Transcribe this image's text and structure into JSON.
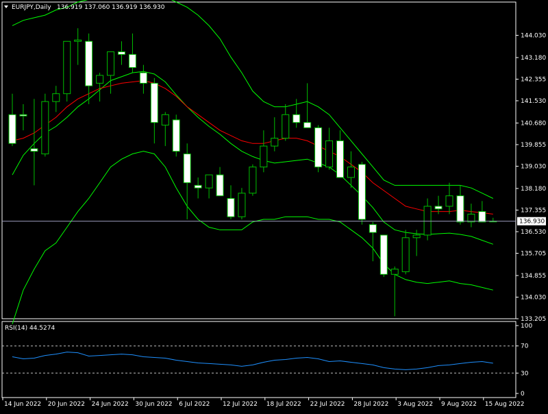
{
  "window": {
    "symbol_title": "EURJPY,Daily",
    "ohlc_readout": "136.919 137.060 136.919 136.930",
    "indicator_label": "RSI(14) 44.5274"
  },
  "colors": {
    "background": "#000000",
    "frame": "#ffffff",
    "bull_candle": "#000000",
    "bear_candle": "#ffffff",
    "candle_outline": "#00c000",
    "ma_middle": "#ff0000",
    "bollinger": "#00ff00",
    "rsi_line": "#1e90ff",
    "price_line": "#a0a0c0",
    "rsi_level": "#c0c0c0"
  },
  "chart_data": [
    {
      "type": "candlestick",
      "price_axis_labels": [
        "144.030",
        "143.180",
        "142.355",
        "141.530",
        "140.680",
        "139.855",
        "139.030",
        "138.180",
        "137.355",
        "136.530",
        "135.705",
        "134.855",
        "134.030",
        "133.205"
      ],
      "current_price_label": "136.930",
      "ylim": [
        133.205,
        145.3
      ],
      "date_labels": [
        "14 Jun 2022",
        "20 Jun 2022",
        "24 Jun 2022",
        "30 Jun 2022",
        "6 Jul 2022",
        "12 Jul 2022",
        "18 Jul 2022",
        "22 Jul 2022",
        "28 Jul 2022",
        "3 Aug 2022",
        "9 Aug 2022",
        "15 Aug 2022"
      ],
      "date_label_bar_index": [
        0,
        4,
        8,
        12,
        16,
        20,
        24,
        28,
        32,
        36,
        40,
        44
      ],
      "candles": [
        {
          "o": 141.0,
          "h": 141.8,
          "l": 139.8,
          "c": 139.9
        },
        {
          "o": 141.0,
          "h": 141.4,
          "l": 140.4,
          "c": 140.95
        },
        {
          "o": 139.7,
          "h": 141.6,
          "l": 138.3,
          "c": 139.6
        },
        {
          "o": 139.5,
          "h": 141.8,
          "l": 139.4,
          "c": 141.5
        },
        {
          "o": 141.5,
          "h": 142.1,
          "l": 141.1,
          "c": 141.8
        },
        {
          "o": 141.8,
          "h": 143.3,
          "l": 141.5,
          "c": 143.8
        },
        {
          "o": 143.8,
          "h": 144.3,
          "l": 142.9,
          "c": 143.85
        },
        {
          "o": 143.8,
          "h": 144.1,
          "l": 141.4,
          "c": 142.1
        },
        {
          "o": 142.2,
          "h": 142.6,
          "l": 141.5,
          "c": 142.5
        },
        {
          "o": 142.5,
          "h": 143.4,
          "l": 141.8,
          "c": 143.4
        },
        {
          "o": 143.4,
          "h": 143.8,
          "l": 142.9,
          "c": 143.3
        },
        {
          "o": 143.3,
          "h": 144.1,
          "l": 142.6,
          "c": 142.8
        },
        {
          "o": 142.6,
          "h": 142.9,
          "l": 141.8,
          "c": 142.2
        },
        {
          "o": 142.2,
          "h": 142.4,
          "l": 139.9,
          "c": 140.7
        },
        {
          "o": 140.6,
          "h": 141.1,
          "l": 139.8,
          "c": 141.0
        },
        {
          "o": 140.8,
          "h": 141.0,
          "l": 139.4,
          "c": 139.6
        },
        {
          "o": 139.5,
          "h": 139.9,
          "l": 137.0,
          "c": 138.4
        },
        {
          "o": 138.3,
          "h": 138.6,
          "l": 137.8,
          "c": 138.2
        },
        {
          "o": 138.2,
          "h": 138.6,
          "l": 137.8,
          "c": 138.7
        },
        {
          "o": 138.7,
          "h": 139.0,
          "l": 137.9,
          "c": 137.9
        },
        {
          "o": 137.8,
          "h": 138.3,
          "l": 137.0,
          "c": 137.1
        },
        {
          "o": 137.1,
          "h": 138.2,
          "l": 137.0,
          "c": 138.0
        },
        {
          "o": 138.0,
          "h": 139.1,
          "l": 137.9,
          "c": 139.0
        },
        {
          "o": 139.0,
          "h": 140.4,
          "l": 138.8,
          "c": 139.8
        },
        {
          "o": 139.8,
          "h": 140.9,
          "l": 139.6,
          "c": 140.1
        },
        {
          "o": 140.1,
          "h": 141.4,
          "l": 140.0,
          "c": 141.0
        },
        {
          "o": 141.0,
          "h": 141.6,
          "l": 140.5,
          "c": 140.7
        },
        {
          "o": 140.7,
          "h": 142.2,
          "l": 140.5,
          "c": 140.5
        },
        {
          "o": 140.5,
          "h": 140.6,
          "l": 138.8,
          "c": 139.0
        },
        {
          "o": 139.0,
          "h": 140.5,
          "l": 138.9,
          "c": 140.0
        },
        {
          "o": 140.0,
          "h": 140.4,
          "l": 138.9,
          "c": 138.6
        },
        {
          "o": 138.6,
          "h": 139.6,
          "l": 138.2,
          "c": 139.0
        },
        {
          "o": 139.1,
          "h": 139.2,
          "l": 136.8,
          "c": 137.0
        },
        {
          "o": 136.8,
          "h": 136.9,
          "l": 135.4,
          "c": 136.5
        },
        {
          "o": 136.4,
          "h": 136.4,
          "l": 134.8,
          "c": 134.9
        },
        {
          "o": 134.9,
          "h": 135.2,
          "l": 133.3,
          "c": 135.1
        },
        {
          "o": 135.0,
          "h": 136.6,
          "l": 134.9,
          "c": 136.3
        },
        {
          "o": 136.3,
          "h": 136.6,
          "l": 135.6,
          "c": 136.4
        },
        {
          "o": 136.4,
          "h": 137.8,
          "l": 136.2,
          "c": 137.5
        },
        {
          "o": 137.5,
          "h": 137.9,
          "l": 137.2,
          "c": 137.4
        },
        {
          "o": 137.5,
          "h": 138.4,
          "l": 137.2,
          "c": 137.9
        },
        {
          "o": 137.9,
          "h": 138.3,
          "l": 136.8,
          "c": 136.9
        },
        {
          "o": 136.9,
          "h": 137.6,
          "l": 136.7,
          "c": 137.2
        },
        {
          "o": 137.3,
          "h": 137.7,
          "l": 136.9,
          "c": 136.9
        },
        {
          "o": 136.919,
          "h": 137.06,
          "l": 136.919,
          "c": 136.93
        }
      ],
      "ma_middle": [
        140.0,
        140.1,
        140.3,
        140.6,
        140.9,
        141.3,
        141.6,
        141.8,
        142.0,
        142.1,
        142.2,
        142.25,
        142.3,
        142.2,
        142.0,
        141.7,
        141.3,
        141.0,
        140.7,
        140.4,
        140.2,
        140.0,
        139.9,
        139.9,
        140.0,
        140.1,
        140.1,
        140.0,
        139.8,
        139.6,
        139.4,
        139.1,
        138.8,
        138.4,
        138.1,
        137.8,
        137.5,
        137.4,
        137.3,
        137.3,
        137.3,
        137.35,
        137.3,
        137.25,
        137.2
      ],
      "bb_upper": [
        144.4,
        144.6,
        144.7,
        144.8,
        145.0,
        145.1,
        145.3,
        145.4,
        145.5,
        145.6,
        145.6,
        145.7,
        145.7,
        145.6,
        145.5,
        145.3,
        145.1,
        144.8,
        144.4,
        143.9,
        143.2,
        142.6,
        141.9,
        141.5,
        141.3,
        141.3,
        141.4,
        141.5,
        141.3,
        141.0,
        140.5,
        140.0,
        139.5,
        139.0,
        138.5,
        138.3,
        138.3,
        138.3,
        138.3,
        138.3,
        138.3,
        138.3,
        138.2,
        138.0,
        137.8
      ],
      "bb_lower": [
        133.0,
        134.3,
        135.1,
        135.8,
        136.1,
        136.7,
        137.3,
        137.8,
        138.4,
        139.0,
        139.3,
        139.5,
        139.6,
        139.5,
        139.0,
        138.2,
        137.5,
        137.0,
        136.7,
        136.6,
        136.6,
        136.6,
        136.9,
        137.0,
        137.0,
        137.1,
        137.1,
        137.1,
        137.0,
        137.0,
        136.9,
        136.6,
        136.3,
        135.9,
        135.3,
        134.9,
        134.7,
        134.6,
        134.55,
        134.6,
        134.65,
        134.55,
        134.5,
        134.4,
        134.3
      ],
      "grid": false
    },
    {
      "type": "line",
      "name": "RSI(14)",
      "axis_labels": [
        "100",
        "70",
        "30",
        "0"
      ],
      "ylim": [
        0,
        100
      ],
      "levels": [
        70,
        30
      ],
      "values": [
        54,
        51,
        52,
        56,
        58,
        61,
        60,
        55,
        56,
        57,
        58,
        57,
        54,
        53,
        52,
        49,
        47,
        45,
        44,
        43,
        42,
        40,
        42,
        46,
        49,
        50,
        52,
        53,
        51,
        47,
        48,
        46,
        44,
        42,
        38,
        36,
        35,
        36,
        38,
        41,
        42,
        44,
        46,
        47,
        44.5
      ]
    }
  ]
}
